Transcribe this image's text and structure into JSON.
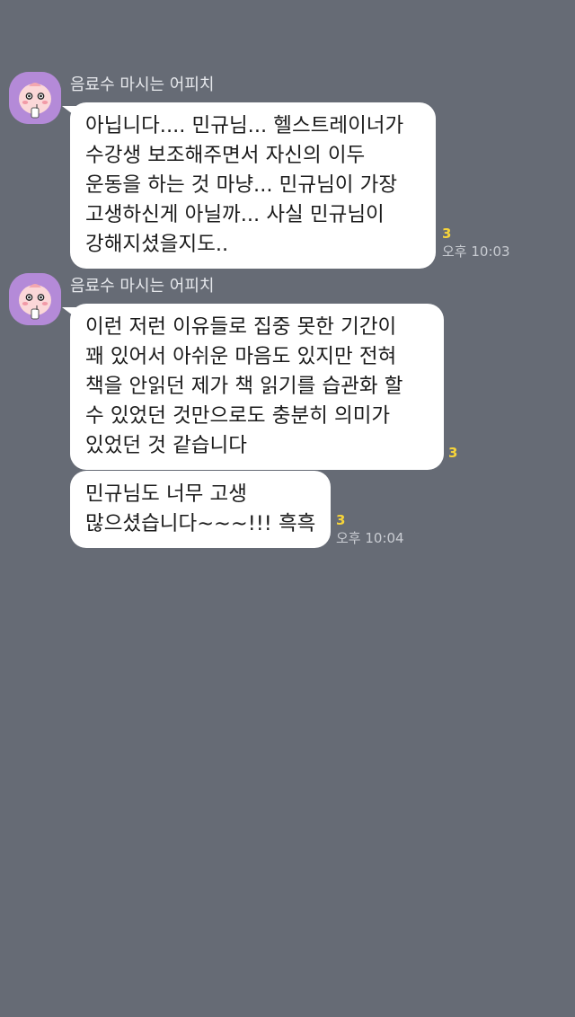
{
  "messages": [
    {
      "sender": "음료수 마시는 어피치",
      "lines": [
        "아닙니다.... 민규님... 헬스트레이너가",
        "수강생 보조해주면서 자신의 이두",
        "운동을 하는 것 마냥... 민규님이 가장",
        "고생하신게 아닐까... 사실 민규님이",
        "강해지셨을지도.."
      ],
      "unread": "3",
      "time": "오후 10:03"
    },
    {
      "sender": "음료수 마시는 어피치",
      "lines": [
        "이런 저런 이유들로 집중 못한 기간이",
        "꽤 있어서 아쉬운 마음도 있지만 전혀",
        "책을 안읽던 제가 책 읽기를 습관화 할",
        "수 있었던 것만으로도 충분히 의미가",
        "있었던 것 같습니다"
      ],
      "unread": "3",
      "time": ""
    },
    {
      "sender": "",
      "lines": [
        "민규님도 너무 고생",
        "많으셨습니다~~~!!! 흑흑"
      ],
      "unread": "3",
      "time": "오후 10:04"
    }
  ],
  "colors": {
    "background": "#666b75",
    "bubble": "#ffffff",
    "unread": "#f6d43a",
    "avatar_bg": "#b48ad8"
  },
  "icons": {
    "avatar": "apeach-character-avatar"
  }
}
